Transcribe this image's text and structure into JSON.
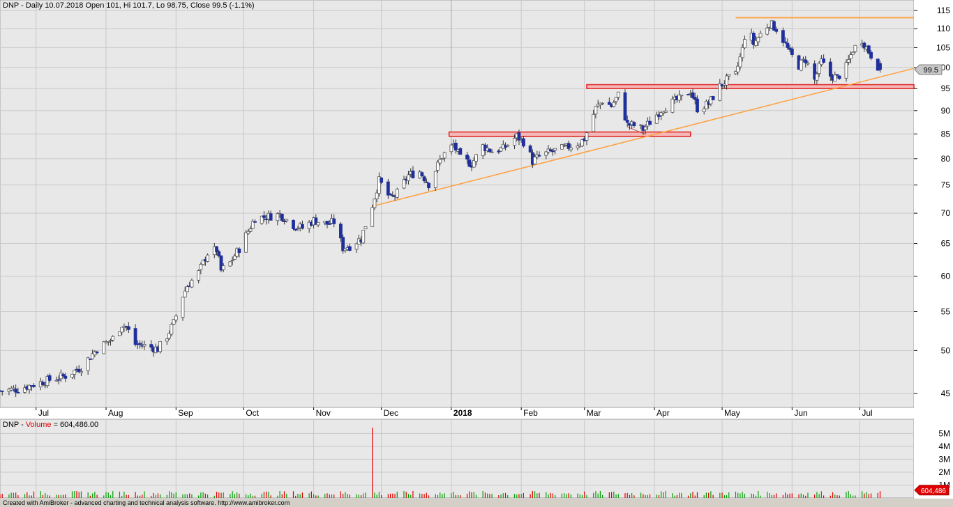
{
  "price_title": "DNP - Daily 10.07.2018 Open 101, Hi 101.7, Lo 98.75, Close 99.5 (-1.1%)",
  "volume_title": {
    "prefix": "DNP - ",
    "label": "Volume",
    "suffix": " = 604,486.00"
  },
  "footer_text": "Created with AmiBroker - advanced charting and technical analysis software. http://www.amibroker.com",
  "colors": {
    "up_body": "#ffffff",
    "down_body": "#1f2f9b",
    "trendline": "#ffa040",
    "resistance": "#e02020",
    "volume_up": "#00a000",
    "volume_down": "#e00000",
    "grid": "#c8c8c8",
    "bg": "#e8e8e8"
  },
  "chart_data": [
    {
      "type": "candlestick",
      "symbol": "DNP",
      "title": "DNP - Daily 10.07.2018 Open 101, Hi 101.7, Lo 98.75, Close 99.5 (-1.1%)",
      "last_close_label": "99.5",
      "y_scale": "log",
      "ylim": [
        43.5,
        118
      ],
      "y_ticks": [
        "45",
        "50",
        "55",
        "60",
        "65",
        "70",
        "75",
        "80",
        "85",
        "90",
        "95",
        "100",
        "105",
        "110",
        "115"
      ],
      "x_range": [
        "2017-06-15",
        "2018-07-25"
      ],
      "x_ticks": [
        {
          "date": "2017-07-01",
          "label": "Jul"
        },
        {
          "date": "2017-08-01",
          "label": "Aug"
        },
        {
          "date": "2017-09-01",
          "label": "Sep"
        },
        {
          "date": "2017-10-01",
          "label": "Oct"
        },
        {
          "date": "2017-11-01",
          "label": "Nov"
        },
        {
          "date": "2017-12-01",
          "label": "Dec"
        },
        {
          "date": "2018-01-01",
          "label": "2018",
          "bold": true
        },
        {
          "date": "2018-02-01",
          "label": "Feb"
        },
        {
          "date": "2018-03-01",
          "label": "Mar"
        },
        {
          "date": "2018-04-01",
          "label": "Apr"
        },
        {
          "date": "2018-05-01",
          "label": "May"
        },
        {
          "date": "2018-06-01",
          "label": "Jun"
        },
        {
          "date": "2018-07-01",
          "label": "Jul"
        }
      ],
      "close_series": [
        [
          "2017-06-15",
          45.3
        ],
        [
          "2017-06-23",
          45.5
        ],
        [
          "2017-07-05",
          46.4
        ],
        [
          "2017-07-14",
          47.0
        ],
        [
          "2017-07-21",
          48.0
        ],
        [
          "2017-07-28",
          50.2
        ],
        [
          "2017-08-04",
          51.5
        ],
        [
          "2017-08-08",
          53.3
        ],
        [
          "2017-08-10",
          53.0
        ],
        [
          "2017-08-14",
          50.8
        ],
        [
          "2017-08-18",
          50.6
        ],
        [
          "2017-08-24",
          50.2
        ],
        [
          "2017-08-28",
          51.8
        ],
        [
          "2017-08-31",
          53.5
        ],
        [
          "2017-09-04",
          57.2
        ],
        [
          "2017-09-06",
          58.6
        ],
        [
          "2017-09-11",
          60.5
        ],
        [
          "2017-09-15",
          63.5
        ],
        [
          "2017-09-19",
          64.0
        ],
        [
          "2017-09-21",
          60.8
        ],
        [
          "2017-09-25",
          62.0
        ],
        [
          "2017-09-29",
          64.2
        ],
        [
          "2017-10-03",
          67.0
        ],
        [
          "2017-10-06",
          69.2
        ],
        [
          "2017-10-11",
          69.4
        ],
        [
          "2017-10-17",
          69.8
        ],
        [
          "2017-10-23",
          68.0
        ],
        [
          "2017-10-27",
          67.5
        ],
        [
          "2017-11-01",
          68.8
        ],
        [
          "2017-11-07",
          68.2
        ],
        [
          "2017-11-10",
          68.5
        ],
        [
          "2017-11-14",
          64.3
        ],
        [
          "2017-11-17",
          64.6
        ],
        [
          "2017-11-22",
          65.8
        ],
        [
          "2017-11-27",
          71.4
        ],
        [
          "2017-11-30",
          75.8
        ],
        [
          "2017-12-05",
          72.5
        ],
        [
          "2017-12-08",
          73.5
        ],
        [
          "2017-12-13",
          76.8
        ],
        [
          "2017-12-18",
          77.5
        ],
        [
          "2017-12-22",
          75.2
        ],
        [
          "2017-12-28",
          80.5
        ],
        [
          "2018-01-02",
          82.8
        ],
        [
          "2018-01-05",
          80.0
        ],
        [
          "2018-01-10",
          79.0
        ],
        [
          "2018-01-15",
          82.5
        ],
        [
          "2018-01-19",
          81.5
        ],
        [
          "2018-01-24",
          82.0
        ],
        [
          "2018-01-30",
          84.5
        ],
        [
          "2018-02-03",
          83.0
        ],
        [
          "2018-02-06",
          79.5
        ],
        [
          "2018-02-09",
          80.5
        ],
        [
          "2018-02-15",
          81.5
        ],
        [
          "2018-02-21",
          82.2
        ],
        [
          "2018-02-27",
          83.2
        ],
        [
          "2018-03-01",
          84.0
        ],
        [
          "2018-03-06",
          90.5
        ],
        [
          "2018-03-09",
          92.2
        ],
        [
          "2018-03-13",
          91.0
        ],
        [
          "2018-03-16",
          93.5
        ],
        [
          "2018-03-20",
          87.0
        ],
        [
          "2018-03-23",
          86.8
        ],
        [
          "2018-03-27",
          86.0
        ],
        [
          "2018-03-30",
          87.5
        ],
        [
          "2018-04-04",
          90.2
        ],
        [
          "2018-04-09",
          91.8
        ],
        [
          "2018-04-13",
          92.8
        ],
        [
          "2018-04-17",
          94.5
        ],
        [
          "2018-04-20",
          90.5
        ],
        [
          "2018-04-25",
          91.5
        ],
        [
          "2018-04-30",
          95.5
        ],
        [
          "2018-05-03",
          97.0
        ],
        [
          "2018-05-07",
          98.2
        ],
        [
          "2018-05-10",
          104.5
        ],
        [
          "2018-05-12",
          111.5
        ],
        [
          "2018-05-15",
          106.0
        ],
        [
          "2018-05-18",
          108.5
        ],
        [
          "2018-05-22",
          111.5
        ],
        [
          "2018-05-25",
          110.0
        ],
        [
          "2018-05-28",
          107.0
        ],
        [
          "2018-05-31",
          103.5
        ],
        [
          "2018-06-04",
          100.5
        ],
        [
          "2018-06-07",
          102.0
        ],
        [
          "2018-06-11",
          97.0
        ],
        [
          "2018-06-14",
          101.5
        ],
        [
          "2018-06-18",
          98.0
        ],
        [
          "2018-06-21",
          97.5
        ],
        [
          "2018-06-25",
          100.2
        ],
        [
          "2018-06-28",
          104.5
        ],
        [
          "2018-07-02",
          107.0
        ],
        [
          "2018-07-05",
          104.0
        ],
        [
          "2018-07-10",
          99.5
        ]
      ],
      "annotations": {
        "support_trendline": {
          "from": [
            "2017-11-27",
            71.2
          ],
          "to": [
            "2018-07-25",
            99.8
          ]
        },
        "secondary_trendline": {
          "from": [
            "2018-03-20",
            86.5
          ],
          "to": [
            "2018-03-28",
            84.9
          ]
        },
        "resistance_bands": [
          {
            "from": "2017-12-31",
            "to": "2018-04-17",
            "low": 84.5,
            "high": 85.4
          },
          {
            "from": "2018-03-02",
            "to": "2018-07-25",
            "low": 95.0,
            "high": 95.9
          }
        ],
        "top_line": {
          "from": "2018-05-07",
          "to": "2018-07-25",
          "value": 113.0
        }
      }
    },
    {
      "type": "bar",
      "title": "DNP - Volume = 604,486.00",
      "last_value_label": "604,486",
      "y_ticks": [
        "1M",
        "2M",
        "3M",
        "4M",
        "5M"
      ],
      "ylim": [
        0,
        6100000
      ],
      "spikes": [
        [
          "2017-11-27",
          5450000,
          "down"
        ],
        [
          "2017-12-10",
          1750000,
          "up"
        ]
      ],
      "baseline_volume": 420000
    }
  ]
}
